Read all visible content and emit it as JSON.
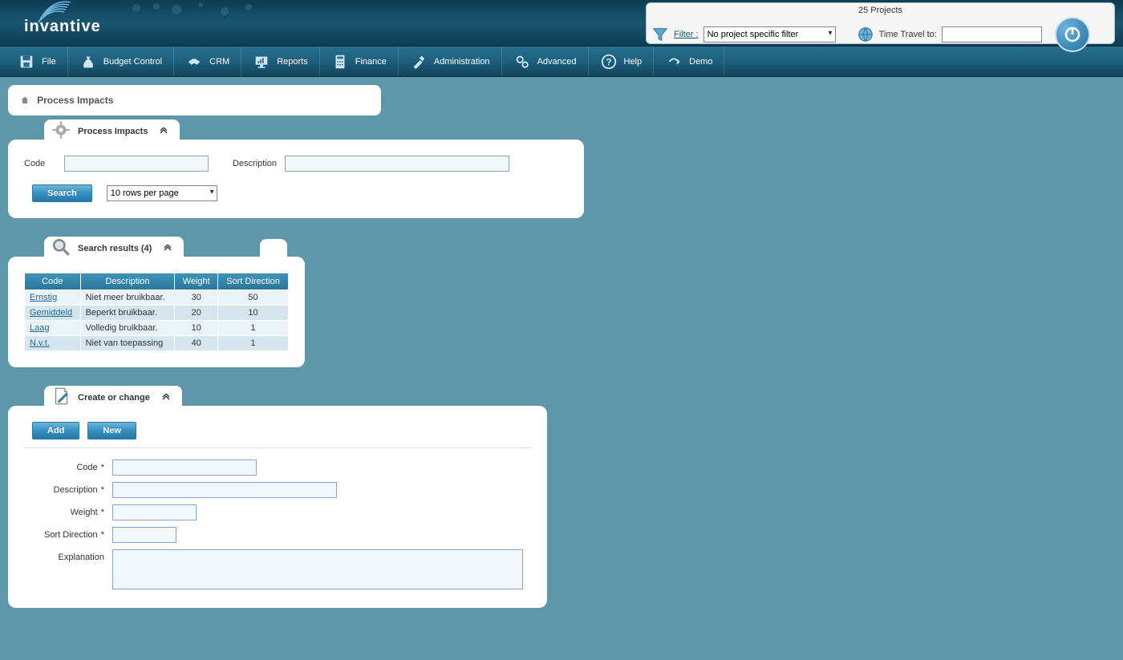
{
  "header": {
    "brand": "invantive",
    "projects_count_label": "25 Projects",
    "filter_label": "Filter",
    "filter_selected": "No project specific filter",
    "timetravel_label": "Time Travel to:",
    "timetravel_value": ""
  },
  "menu": {
    "items": [
      {
        "label": "File",
        "icon": "save-icon"
      },
      {
        "label": "Budget Control",
        "icon": "money-bag-icon"
      },
      {
        "label": "CRM",
        "icon": "handshake-icon"
      },
      {
        "label": "Reports",
        "icon": "chart-screen-icon"
      },
      {
        "label": "Finance",
        "icon": "calculator-icon"
      },
      {
        "label": "Administration",
        "icon": "tools-icon"
      },
      {
        "label": "Advanced",
        "icon": "gears-icon"
      },
      {
        "label": "Help",
        "icon": "question-icon"
      },
      {
        "label": "Demo",
        "icon": "demo-icon"
      }
    ]
  },
  "breadcrumb": {
    "title": "Process Impacts"
  },
  "search_panel": {
    "title": "Process Impacts",
    "code_label": "Code",
    "code_value": "",
    "description_label": "Description",
    "description_value": "",
    "search_button": "Search",
    "rows_per_page": "10 rows per page"
  },
  "results_panel": {
    "title": "Search results (4)",
    "columns": [
      "Code",
      "Description",
      "Weight",
      "Sort Direction"
    ],
    "rows": [
      {
        "code": "Ernstig",
        "description": "Niet meer bruikbaar.",
        "weight": 30,
        "sort": 50
      },
      {
        "code": "Gemiddeld",
        "description": "Beperkt bruikbaar.",
        "weight": 20,
        "sort": 10
      },
      {
        "code": "Laag",
        "description": "Volledig bruikbaar.",
        "weight": 10,
        "sort": 1
      },
      {
        "code": "N.v.t.",
        "description": "Niet van toepassing",
        "weight": 40,
        "sort": 1
      }
    ]
  },
  "edit_panel": {
    "title": "Create or change",
    "add_button": "Add",
    "new_button": "New",
    "fields": {
      "code_label": "Code",
      "code_value": "",
      "description_label": "Description",
      "description_value": "",
      "weight_label": "Weight",
      "weight_value": "",
      "sort_label": "Sort Direction",
      "sort_value": "",
      "explanation_label": "Explanation",
      "explanation_value": ""
    }
  }
}
